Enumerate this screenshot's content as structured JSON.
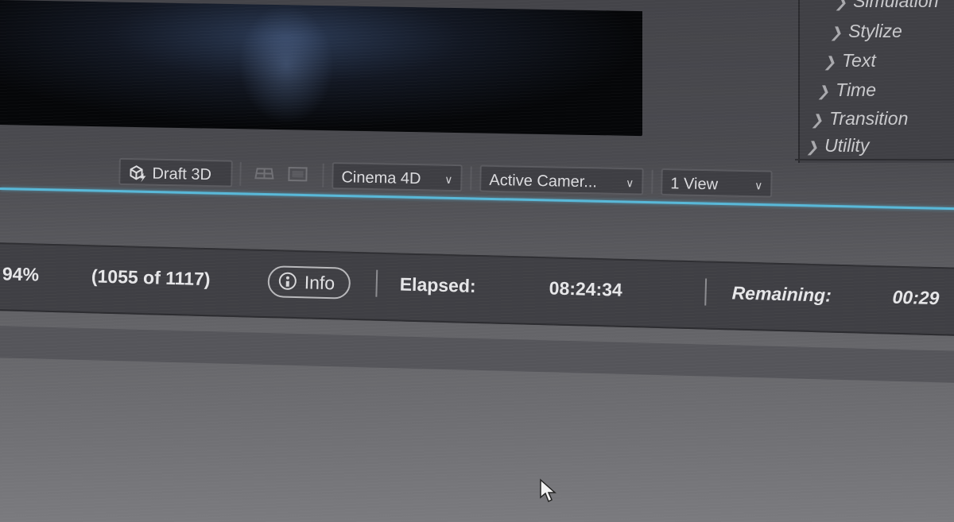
{
  "effects_panel": {
    "items": [
      {
        "label": "Simulation"
      },
      {
        "label": "Stylize"
      },
      {
        "label": "Text"
      },
      {
        "label": "Time"
      },
      {
        "label": "Transition"
      },
      {
        "label": "Utility"
      }
    ]
  },
  "toolbar": {
    "draft3d_label": "Draft 3D",
    "renderer": {
      "selected": "Cinema 4D"
    },
    "camera": {
      "selected": "Active Camer..."
    },
    "views": {
      "selected": "1 View"
    },
    "accent_color": "#58b8d8"
  },
  "render_status": {
    "progress_percent_label": "94%",
    "progress_percent": 94,
    "frames_label": "(1055 of 1117)",
    "info_label": "Info",
    "elapsed_label": "Elapsed:",
    "elapsed_value": "08:24:34",
    "remaining_label": "Remaining:",
    "remaining_value": "00:29"
  }
}
